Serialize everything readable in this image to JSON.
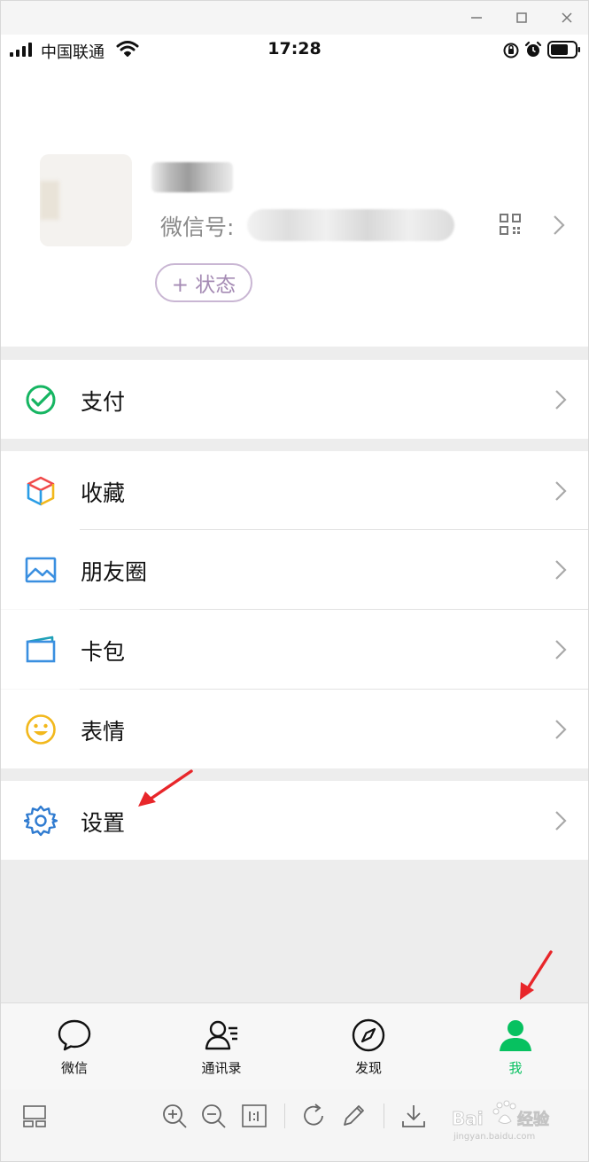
{
  "status_bar": {
    "carrier": "中国联通",
    "time": "17:28"
  },
  "profile": {
    "wechat_id_label": "微信号:",
    "status_button": "+ 状态"
  },
  "menu": {
    "pay": "支付",
    "favorites": "收藏",
    "moments": "朋友圈",
    "cards": "卡包",
    "stickers": "表情",
    "settings": "设置"
  },
  "tabs": [
    {
      "label": "微信",
      "icon": "chat-bubble-icon"
    },
    {
      "label": "通讯录",
      "icon": "contacts-icon"
    },
    {
      "label": "发现",
      "icon": "compass-icon"
    },
    {
      "label": "我",
      "icon": "person-icon",
      "active": true
    }
  ],
  "colors": {
    "accent_green": "#07c160",
    "annotation_red": "#e8262a",
    "pay_green": "#16b562",
    "settings_blue": "#2f7bd0"
  },
  "watermark": {
    "text": "Baidu 经验",
    "subtext": "jingyan.baidu.com"
  }
}
